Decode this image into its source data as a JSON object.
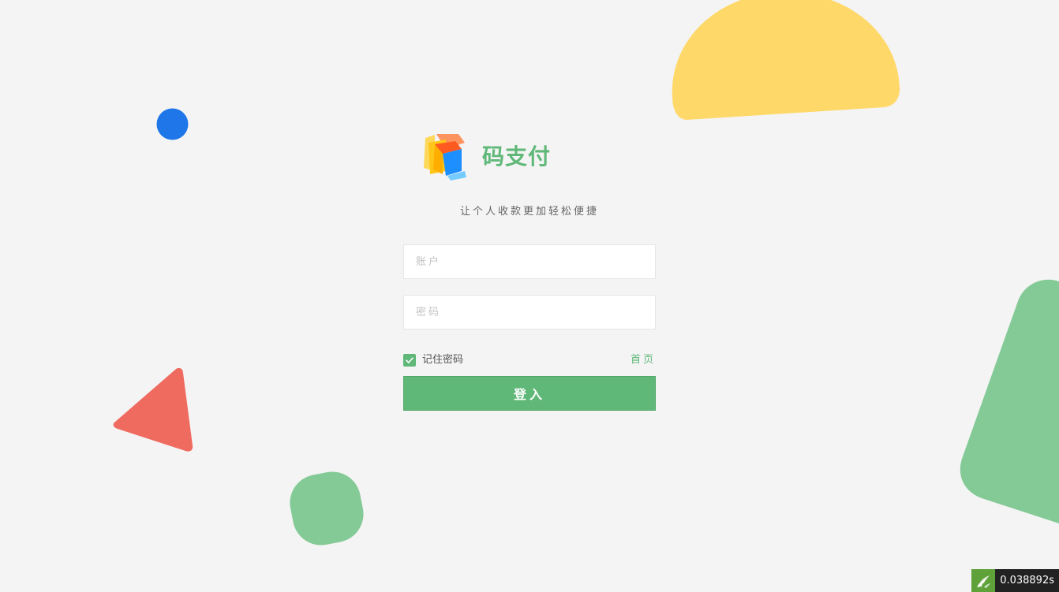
{
  "brand": {
    "name": "码支付",
    "tagline": "让个人收款更加轻松便捷",
    "logo_icon": "cube-logo-icon"
  },
  "form": {
    "username": {
      "placeholder": "账户",
      "value": ""
    },
    "password": {
      "placeholder": "密码",
      "value": ""
    },
    "remember": {
      "label": "记住密码",
      "checked": true
    },
    "home_link": "首页",
    "submit_label": "登入"
  },
  "debug": {
    "timer_value": "0.038892s",
    "timer_icon": "flame-logo-icon"
  },
  "colors": {
    "accent": "#5fb878",
    "background": "#f4f4f4",
    "yellow": "#ffd86a",
    "blue": "#1e76e8",
    "red": "#ef6a5f",
    "green_shape": "#84ca96"
  }
}
